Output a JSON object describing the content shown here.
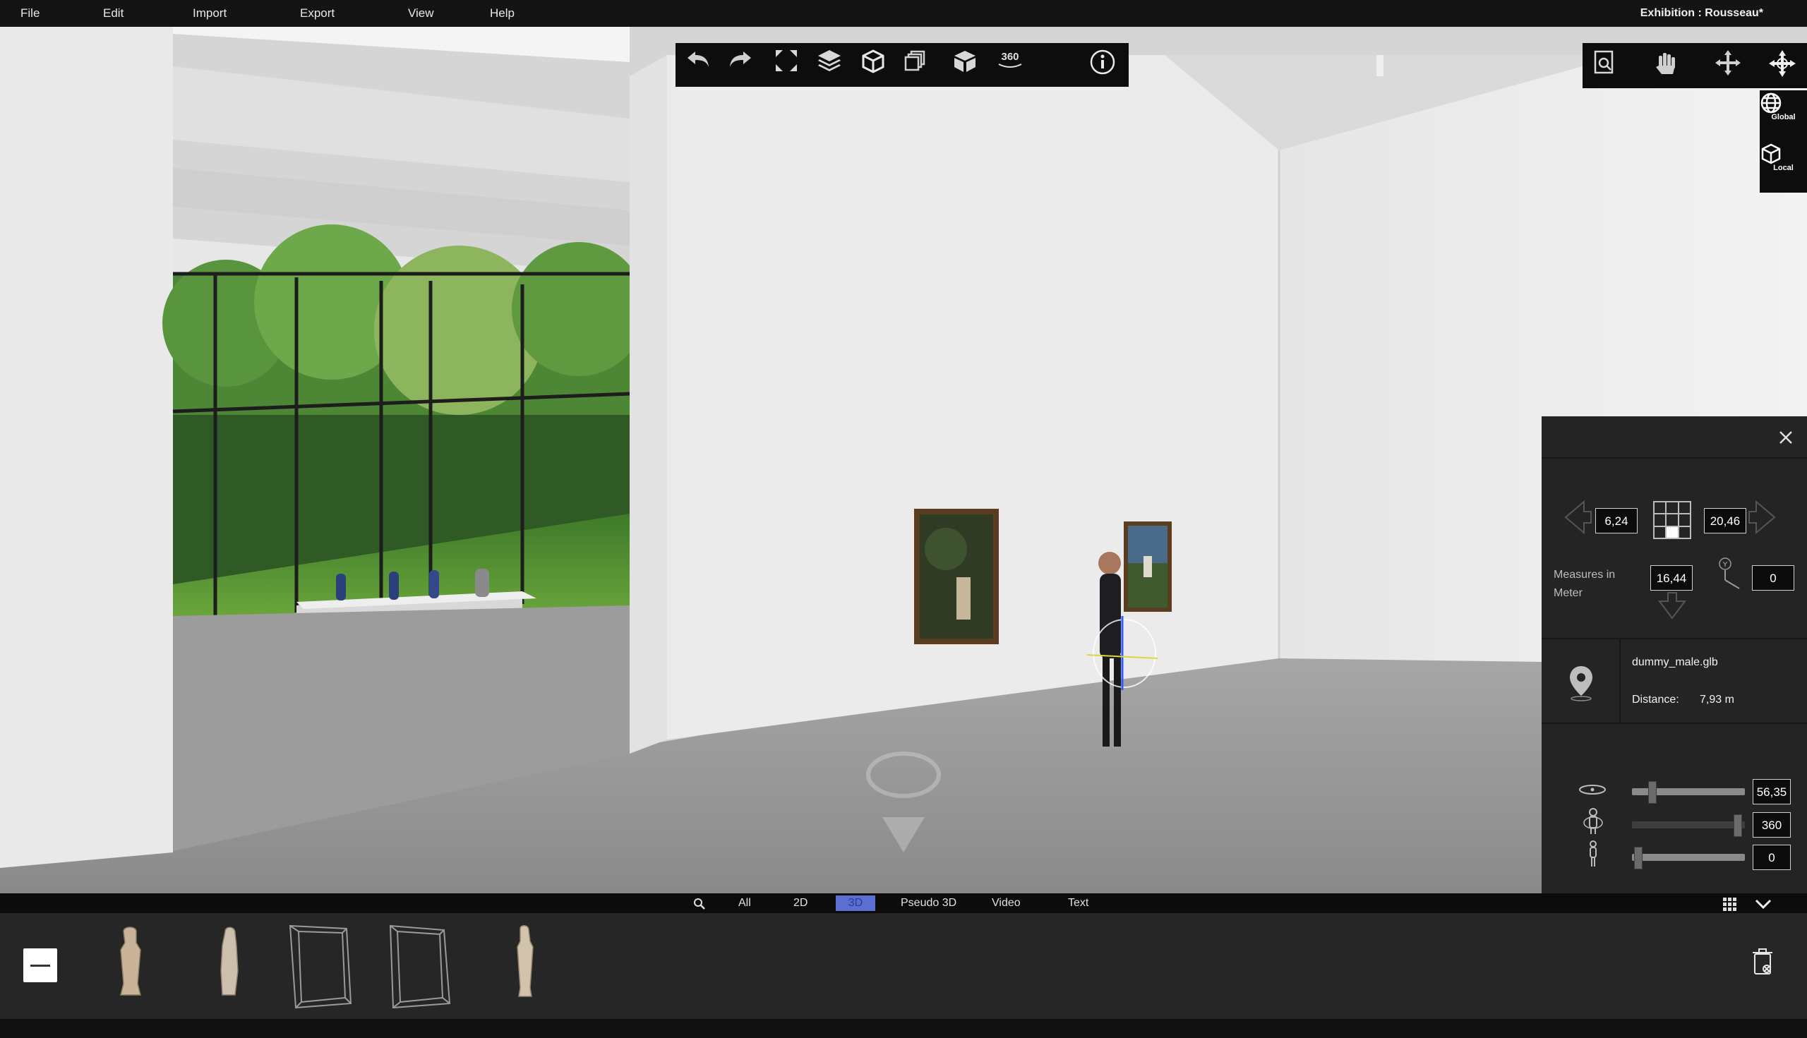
{
  "menu": {
    "items": [
      {
        "label": "File"
      },
      {
        "label": "Edit"
      },
      {
        "label": "Import"
      },
      {
        "label": "Export"
      },
      {
        "label": "View"
      },
      {
        "label": "Help"
      }
    ],
    "exhibition_title": "Exhibition : Rousseau*"
  },
  "toolbar": {
    "icons": [
      "undo-icon",
      "redo-icon",
      "fullscreen-icon",
      "layers-icon",
      "cube-icon",
      "view-stack-icon",
      "box-3d-icon",
      "panorama-360-icon",
      "info-icon"
    ],
    "panorama_label": "360"
  },
  "right_tools": {
    "icons": [
      "document-search-icon",
      "hand-pan-icon",
      "move-arrows-icon",
      "rotate-move-icon"
    ]
  },
  "coord_toggle": {
    "global_label": "Global",
    "local_label": "Local"
  },
  "panel": {
    "pos_x": "6,24",
    "pos_z": "20,46",
    "pos_depth": "16,44",
    "pos_y": "0",
    "y_axis_label": "Y",
    "measures_label": "Measures in Meter",
    "object_name": "dummy_male.glb",
    "distance_label": "Distance:",
    "distance_value": "7,93 m",
    "slider_rotation_value": "56,35",
    "slider_angle_value": "360",
    "slider_height_value": "0",
    "slider_rotation_fraction": 0.15,
    "slider_angle_fraction": 0.96,
    "slider_height_fraction": 0.02
  },
  "filter": {
    "tabs": [
      {
        "label": "All",
        "active": false
      },
      {
        "label": "2D",
        "active": false
      },
      {
        "label": "3D",
        "active": true
      },
      {
        "label": "Pseudo 3D",
        "active": false
      },
      {
        "label": "Video",
        "active": false
      },
      {
        "label": "Text",
        "active": false
      }
    ]
  },
  "tray": {
    "assets": [
      "sculpture-statue-1",
      "sculpture-statue-2",
      "glass-vitrine-1",
      "glass-vitrine-2",
      "sculpture-statue-3"
    ]
  },
  "colors": {
    "accent": "#5a6fd1",
    "panel_bg": "#242424",
    "menubar_bg": "#141414"
  }
}
